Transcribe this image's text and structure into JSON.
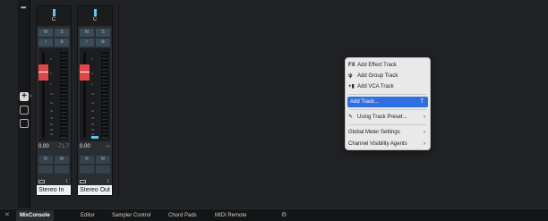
{
  "toolbar": {
    "more_label": "•••",
    "add_label": "+"
  },
  "strips": [
    {
      "channel_letter": "C",
      "buttons_row1": [
        "M",
        "S"
      ],
      "buttons_row2": [
        "•",
        "⊕"
      ],
      "scale_labels": [
        "6",
        "0",
        "6",
        "10",
        "20",
        "30",
        "40",
        "50",
        "60",
        "90"
      ],
      "volume": "0.00",
      "peak": "-71.7",
      "buttons_row3": [
        "R",
        "W"
      ],
      "buttons_row4": [
        "",
        ""
      ],
      "io_number": "1",
      "name": "Stereo In"
    },
    {
      "channel_letter": "C",
      "buttons_row1": [
        "M",
        "S"
      ],
      "buttons_row2": [
        "•",
        "⊕"
      ],
      "scale_labels": [
        "6",
        "0",
        "6",
        "10",
        "20",
        "30",
        "40",
        "50",
        "60",
        "90"
      ],
      "volume": "0.00",
      "peak": "-∞",
      "buttons_row3": [
        "R",
        "W"
      ],
      "buttons_row4": [
        "",
        ""
      ],
      "io_number": "1",
      "name": "Stereo Out"
    }
  ],
  "context_menu": {
    "items": [
      {
        "icon": "FX",
        "label": "Add Effect Track",
        "shortcut": ""
      },
      {
        "icon": "ψ",
        "label": "Add Group Track",
        "shortcut": ""
      },
      {
        "icon": "+▮",
        "label": "Add VCA Track",
        "shortcut": ""
      },
      {
        "icon": "",
        "label": "Add Track...",
        "shortcut": "T"
      },
      {
        "icon": "✎",
        "label": "Using Track Preset...",
        "shortcut": "›"
      },
      {
        "icon": "",
        "label": "Global Meter Settings",
        "shortcut": "›"
      },
      {
        "icon": "",
        "label": "Channel Visibility Agents",
        "shortcut": "›"
      }
    ]
  },
  "bottom_tabs": [
    "MixConsole",
    "Editor",
    "Sampler Control",
    "Chord Pads",
    "MIDI Remote"
  ],
  "close_label": "✕",
  "settings_label": "⚙"
}
